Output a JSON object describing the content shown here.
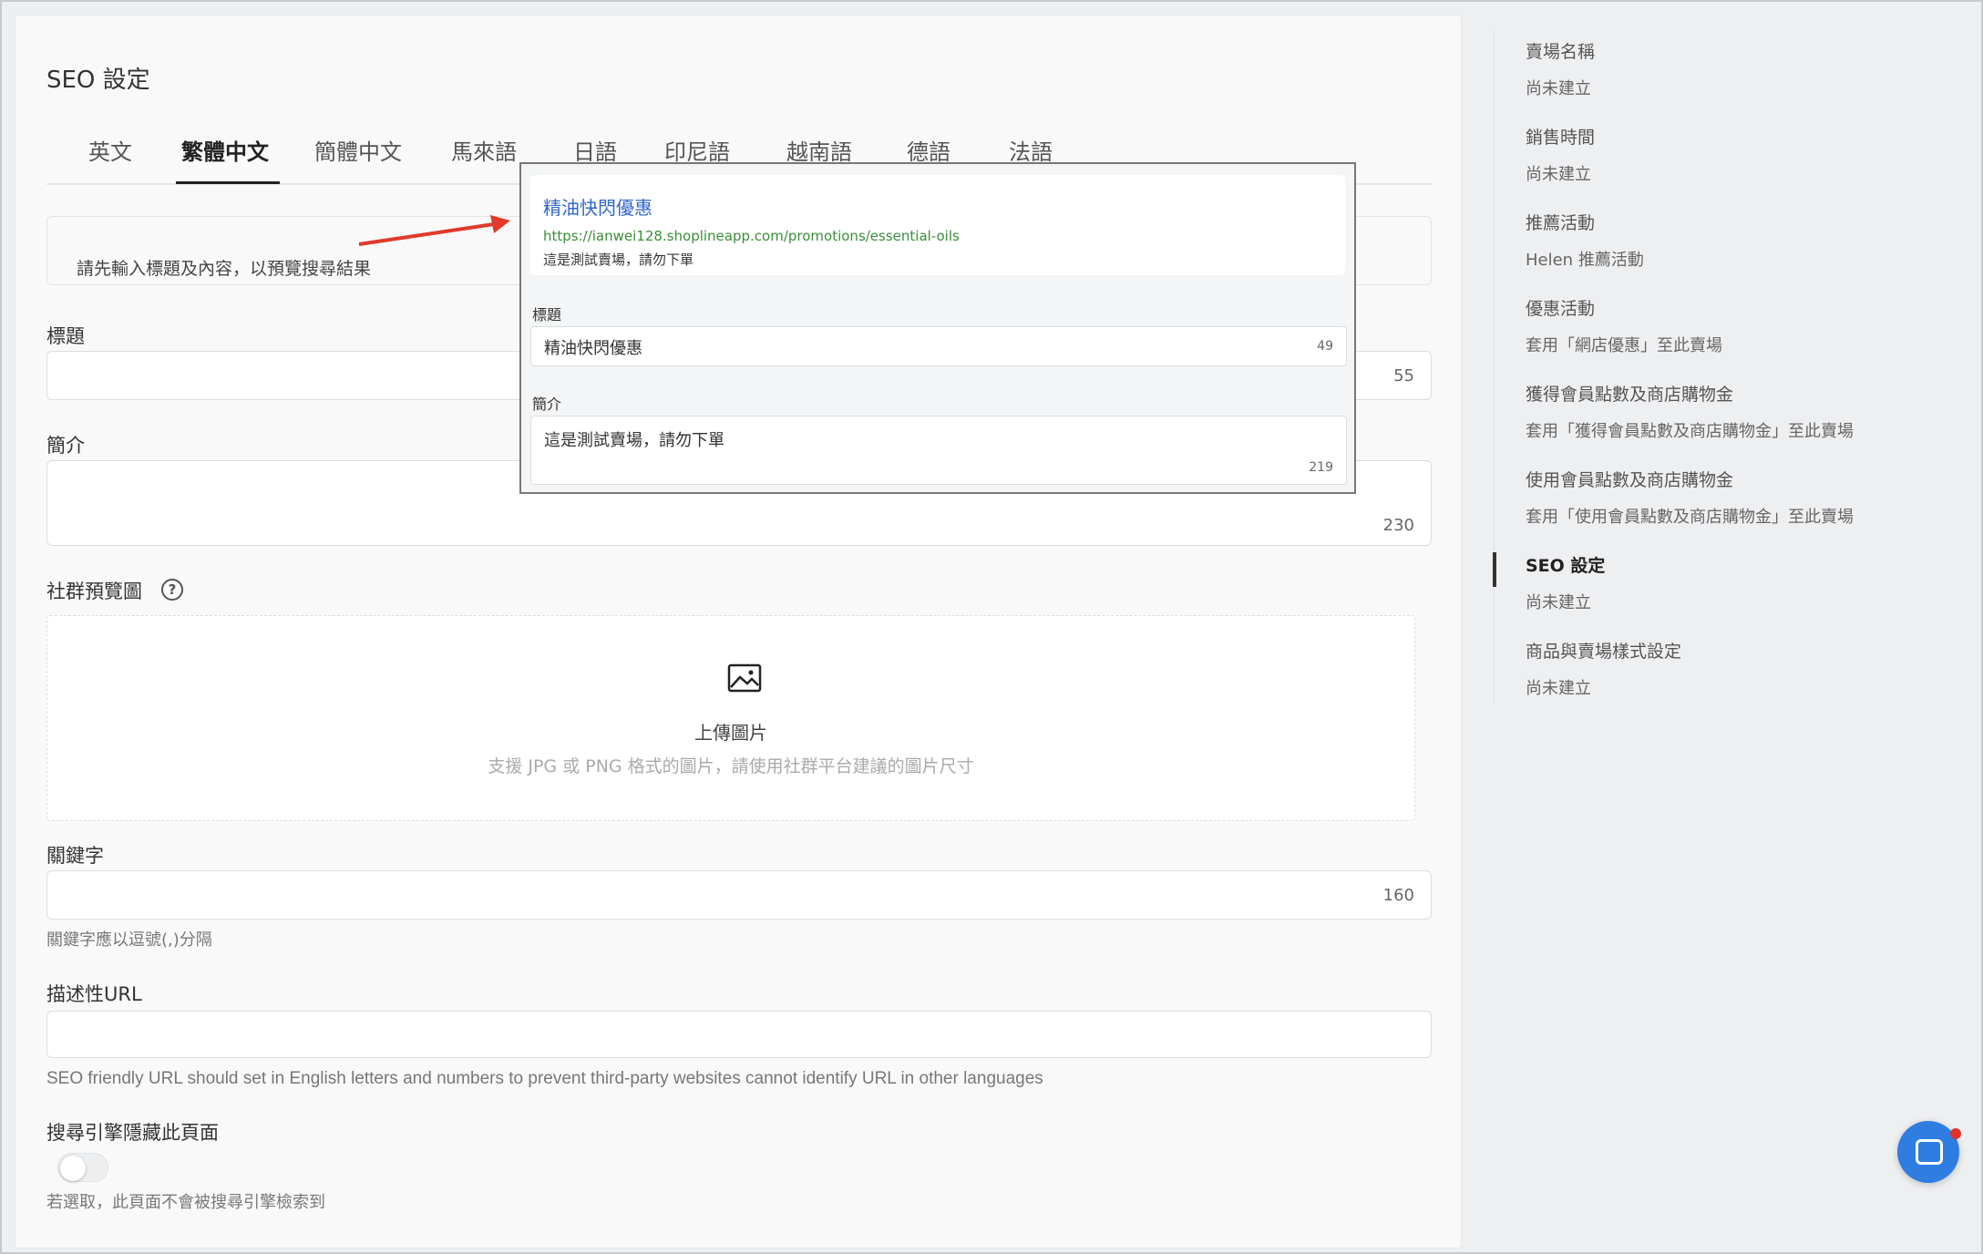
{
  "page": {
    "title": "SEO 設定",
    "tabs": [
      {
        "label": "英文"
      },
      {
        "label": "繁體中文"
      },
      {
        "label": "簡體中文"
      },
      {
        "label": "馬來語"
      },
      {
        "label": "日語"
      },
      {
        "label": "印尼語"
      },
      {
        "label": "越南語"
      },
      {
        "label": "德語"
      },
      {
        "label": "法語"
      }
    ],
    "active_tab": "繁體中文",
    "hint": "請先輸入標題及內容，以預覽搜尋結果",
    "fields": {
      "title_label": "標題",
      "title_count": "55",
      "intro_label": "簡介",
      "intro_count": "230",
      "social_label": "社群預覽圖",
      "upload_title": "上傳圖片",
      "upload_sub": "支援 JPG 或 PNG 格式的圖片，請使用社群平台建議的圖片尺寸",
      "keywords_label": "關鍵字",
      "keywords_count": "160",
      "keywords_helper": "關鍵字應以逗號(,)分隔",
      "url_label": "描述性URL",
      "url_helper": "SEO friendly URL should set in English letters and numbers to prevent third-party websites cannot identify URL in other languages",
      "hide_label": "搜尋引擎隱藏此頁面",
      "hide_helper": "若選取，此頁面不會被搜尋引擎檢索到",
      "hide_enabled": false
    }
  },
  "popup": {
    "preview_title": "精油快閃優惠",
    "preview_url": "https://ianwei128.shoplineapp.com/promotions/essential-oils",
    "preview_desc": "這是測試賣場，請勿下單",
    "title_label": "標題",
    "title_value": "精油快閃優惠",
    "title_count": "49",
    "intro_label": "簡介",
    "intro_value": "這是測試賣場，請勿下單",
    "intro_count": "219"
  },
  "sidebar": {
    "items": [
      {
        "title": "賣場名稱",
        "sub": "尚未建立"
      },
      {
        "title": "銷售時間",
        "sub": "尚未建立"
      },
      {
        "title": "推薦活動",
        "sub": "Helen 推薦活動"
      },
      {
        "title": "優惠活動",
        "sub": "套用「網店優惠」至此賣場"
      },
      {
        "title": "獲得會員點數及商店購物金",
        "sub": "套用「獲得會員點數及商店購物金」至此賣場"
      },
      {
        "title": "使用會員點數及商店購物金",
        "sub": "套用「使用會員點數及商店購物金」至此賣場"
      },
      {
        "title": "SEO 設定",
        "sub": "尚未建立"
      },
      {
        "title": "商品與賣場樣式設定",
        "sub": "尚未建立"
      }
    ],
    "active": "SEO 設定"
  },
  "colors": {
    "link_blue": "#3366cc",
    "url_green": "#3a8e3a",
    "arrow_red": "#e03a2a",
    "chat_blue": "#2f7de1"
  },
  "icons": [
    "help-icon",
    "image-icon",
    "chat-icon",
    "arrow-annotation"
  ]
}
